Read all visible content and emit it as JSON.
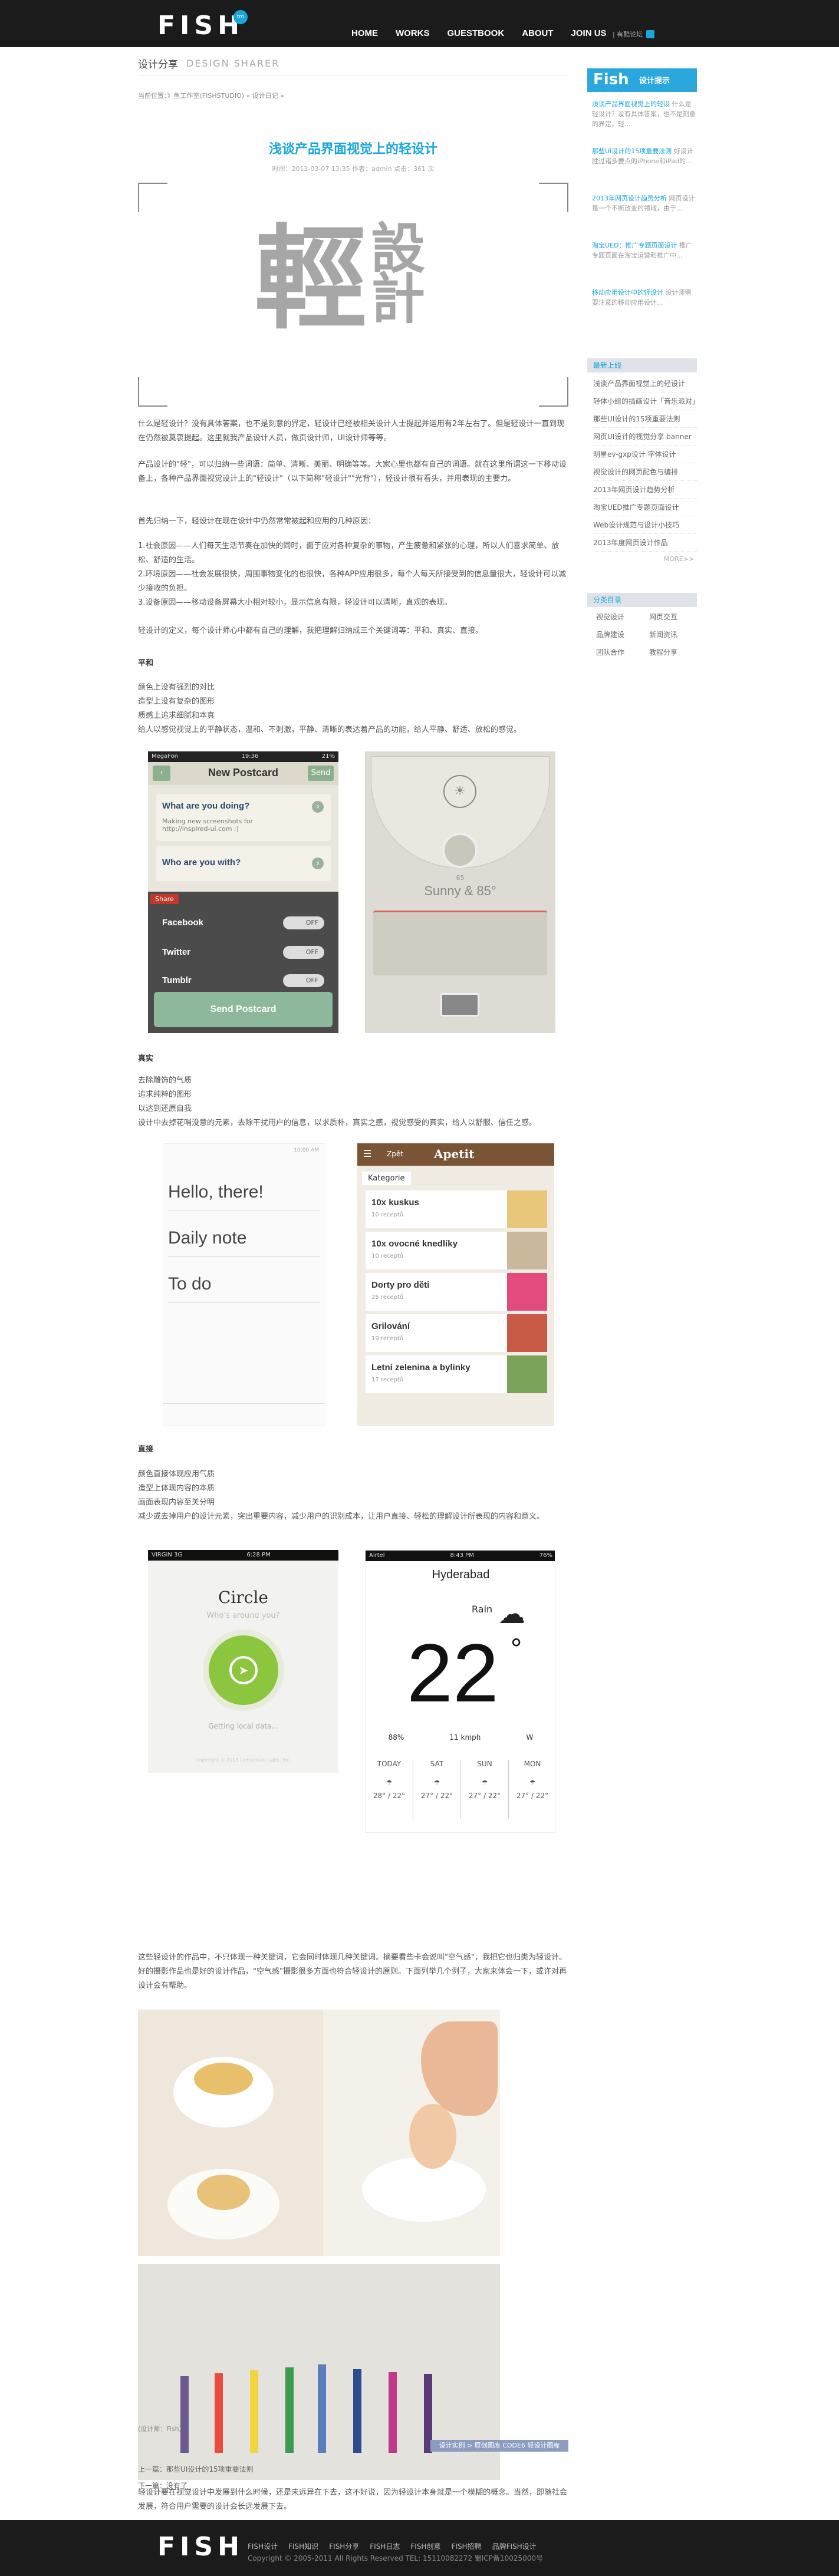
{
  "header": {
    "logo": "FISH",
    "logo_badge": "tm",
    "nav": [
      "HOME",
      "WORKS",
      "GUESTBOOK",
      "ABOUT",
      "JOIN US"
    ],
    "subscribe": "|  有酷论坛"
  },
  "section": {
    "cn": "设计分享",
    "en": "DESIGN SHARER"
  },
  "breadcrumb": "当前位置：》鱼工作室(FISHSTUDIO) » 设计日记 »",
  "article": {
    "title": "浅谈产品界面视觉上的轻设计",
    "meta": "时间：2013-03-07 13:35   作者：admin   点击：361 次",
    "hero_big": "輕",
    "hero_small": "設計",
    "p1": "什么是轻设计？没有具体答案，也不是刻意的界定，轻设计已经被相关设计人士提起并运用有2年左右了。但是轻设计一直到现在仍然被莫衷提起。这里就我产品设计人员，做页设计师，UI设计师等等。",
    "p1_link": "轻设计",
    "p2": "产品设计的\"轻\"，可以归纳一些词语：简单、清晰、美丽、明确等等。大家心里也都有自己的词语。就在这里所谓这一下移动设备上，各种产品界面视觉设计上的\"轻设计\"（以下简称\"轻设计\"\"光背\"），轻设计很有看头，并用表现的主要力。",
    "p3": "首先归纳一下，轻设计在现在设计中仍然常常被起和应用的几种原因：",
    "p4": "1.社会原因——人们每天生活节奏在加快的同时，面于应对各种复杂的事物，产生疲惫和紧张的心理，所以人们喜求简单、放松、舒适的生活。\n2.环境原因——社会发展很快，周围事物变化的也很快，各种APP应用很多，每个人每天所接受到的信息量很大，轻设计可以减少接收的负担。\n3.设备原因——移动设备屏幕大小相对较小，显示信息有限，轻设计可以清晰，直观的表现。",
    "p5": "轻设计的定义，每个设计师心中都有自己的理解，我把理解归纳成三个关键词等：平和、真实、直接。",
    "h_ping": "平和",
    "ping_list": "颜色上没有强烈的对比\n造型上没有复杂的图形\n质感上追求细腻和本真\n给人以感觉视觉上的平静状态，温和、不刺激，平静、清晰的表达着产品的功能，给人平静、舒适、放松的感觉。",
    "h_zhen": "真实",
    "zhen_list": "去除雕饰的气质\n追求纯粹的图形\n以达到还原自我\n设计中去掉花哨没意的元素，去除干扰用户的信息，以求质朴，真实之感，视觉感受的真实，给人以舒服、信任之感。",
    "h_zhi": "直接",
    "zhi_list": "颜色直接体现应用气质\n造型上体现内容的本质\n画面表现内容至关分明\n减少或去掉用户的设计元素，突出重要内容，减少用户的识别成本，让用户直接、轻松的理解设计所表现的内容和意义。",
    "p6": "这些轻设计的作品中，不只体现一种关键词，它会同时体现几种关键词。摘要看些卡会说叫\"空气感\"，我把它也归类为轻设计。好的摄影作品也是好的设计作品，\"空气感\"摄影很多方面也符合轻设计的原则。下面列举几个例子，大家来体会一下，或许对再设计会有帮助。",
    "p7": "轻设计要在视觉设计中发展到什么时候，还是未远异在下去，这不好说，因为轻设计本身就是一个模糊的概念。当然，即随社会发展，符合用户需要的设计会长远发展下去。",
    "p7_link": "(设计师：Fish）",
    "tags": "设计实例 > 原创图库   CODE6   轻设计图库",
    "prev": "上一篇：那些UI设计的15项重要法则",
    "next": "下一篇：没有了"
  },
  "screens": {
    "postcard": {
      "status_left": "MegaFon",
      "time": "19:36",
      "battery": "21%",
      "back": "‹",
      "title": "New Postcard",
      "send": "Send",
      "q1": "What are you doing?",
      "q1_body": "Making new screenshots for http://inspired-ui.com :)",
      "q2": "Who are you with?",
      "share": "Share",
      "rows": [
        "Facebook",
        "Twitter",
        "Tumblr"
      ],
      "toggle": "OFF",
      "button": "Send Postcard"
    },
    "weather_dial": {
      "temp": "Sunny & 85°",
      "small": "65"
    },
    "notes": {
      "clock": "10:00 AM",
      "items": [
        "Hello, there!",
        "Daily note",
        "To do"
      ]
    },
    "apetit": {
      "left": "Zpět",
      "brand": "Apetit",
      "heading": "Kategorie",
      "items": [
        "10x kuskus",
        "10x ovocné knedlíky",
        "Dorty pro děti",
        "Grilování",
        "Letní zelenina a bylinky"
      ],
      "sub": "receptů",
      "counts": [
        "10",
        "10",
        "25",
        "19",
        "17"
      ]
    },
    "circle": {
      "status": "VIRGIN 3G",
      "time": "6:28 PM",
      "title": "Circle",
      "subtitle": "Who's around you?",
      "loading": "Getting local data...",
      "foot": "Copyright © 2013 Lomonosov Labs, Inc."
    },
    "hyderabad": {
      "status": "Airtel",
      "time": "8:43 PM",
      "battery": "76%",
      "city": "Hyderabad",
      "cond": "Rain",
      "temp": "22",
      "deg": "°",
      "humidity": "88%",
      "wind": "11 kmph",
      "dir": "W",
      "days": [
        "TODAY",
        "SAT",
        "SUN",
        "MON"
      ],
      "temps": [
        "28° / 22°",
        "27° / 22°",
        "27° / 22°",
        "27° / 22°"
      ]
    }
  },
  "sidebar": {
    "logo_a": "Fish",
    "logo_b": "设计提示",
    "news": [
      [
        "浅谈产品界面视觉上的轻设",
        "什么是轻设计？没有具体答案，也不是刻意的界定，轻..."
      ],
      [
        "那些UI设计的15项重要法则",
        "好设计胜过诸多要点的iPhone和iPad的..."
      ],
      [
        "2013年网页设计趋势分析",
        "网页设计是一个不断改变的领域，由于..."
      ],
      [
        "淘宝UED：推广专题页面设计",
        "推广专题页面在淘宝运营和推广中..."
      ],
      [
        "移动应用设计中的轻设计",
        "设计师需要注意的移动应用设计..."
      ]
    ],
    "latest_label": "最新上线",
    "latest": [
      "浅谈产品界面视觉上的轻设计",
      "轻体小组的插画设计「音乐派对」",
      "那些UI设计的15项重要法则",
      "网页UI设计的视觉分享 banner",
      "明星ev-gxp设计 字体设计",
      "视觉设计的网页配色与编排",
      "2013年网页设计趋势分析",
      "淘宝UED推广专题页面设计",
      "Web设计规范与设计小技巧",
      "2013年度网页设计作品"
    ],
    "more": "MORE>>",
    "cat_label": "分类目录",
    "cats": [
      [
        "视觉设计",
        "网页交互"
      ],
      [
        "品牌建设",
        "新闻资讯"
      ],
      [
        "团队合作",
        "教程分享"
      ]
    ]
  },
  "footer": {
    "logo": "FISH",
    "links": [
      "FISH设计",
      "FISH知识",
      "FISH分享",
      "FISH日志",
      "FISH创意",
      "FISH招聘",
      "品牌FISH设计"
    ],
    "copy": "Copyright © 2005-2011 All Rights Reserved TEL: 15110082272 蜀ICP备10025000号"
  }
}
